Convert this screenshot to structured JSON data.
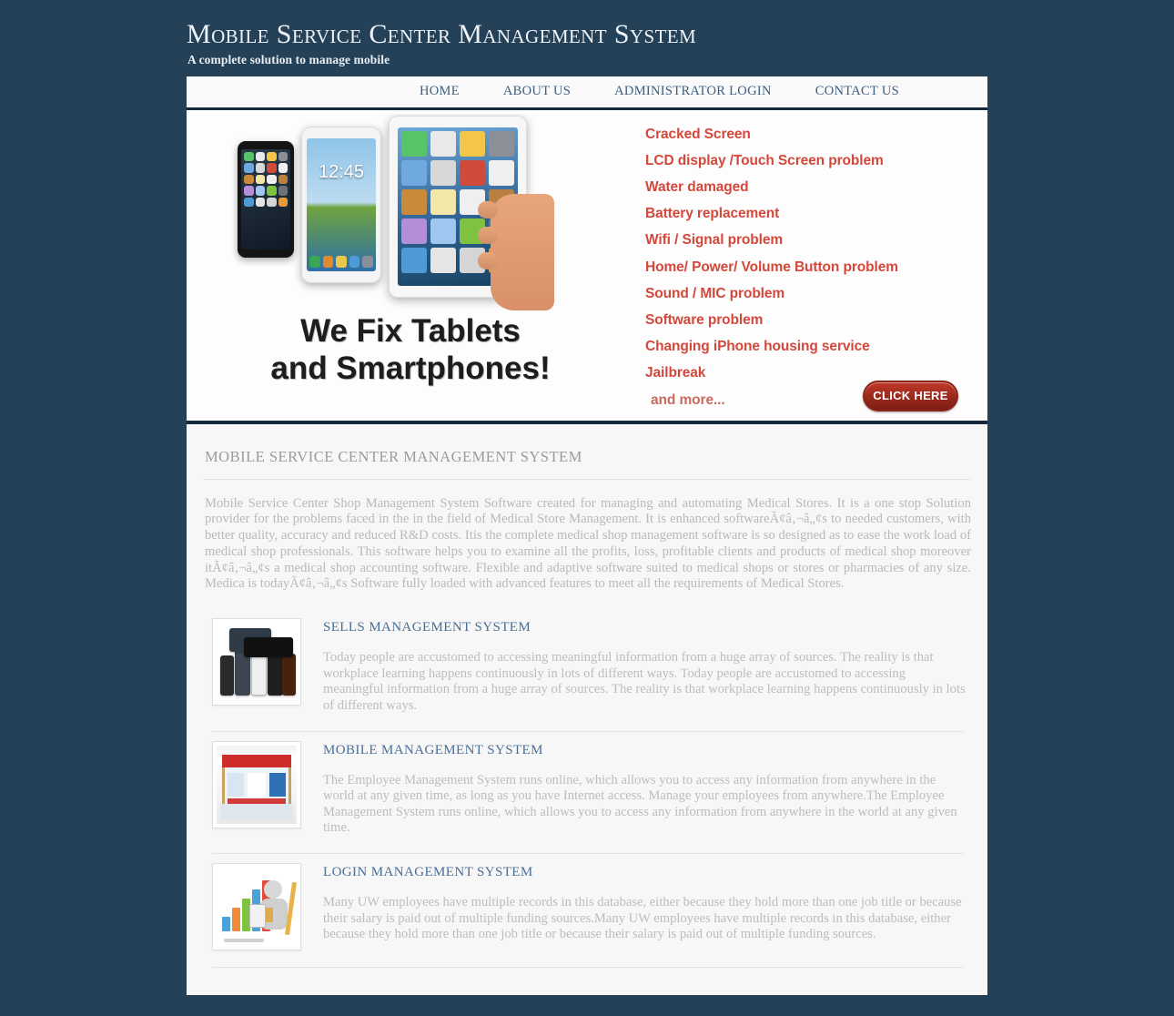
{
  "site": {
    "title": "Mobile Service Center Management System",
    "tagline": "A complete solution to manage mobile"
  },
  "nav": {
    "items": [
      {
        "label": "HOME",
        "name": "nav-home"
      },
      {
        "label": "ABOUT US",
        "name": "nav-about-us"
      },
      {
        "label": "ADMINISTRATOR LOGIN",
        "name": "nav-administrator-login"
      },
      {
        "label": "CONTACT US",
        "name": "nav-contact-us"
      }
    ]
  },
  "banner": {
    "headline_line1": "We Fix Tablets",
    "headline_line2": "and Smartphones!",
    "services": [
      "Cracked Screen",
      "LCD display /Touch Screen problem",
      "Water damaged",
      "Battery replacement",
      "Wifi / Signal problem",
      "Home/ Power/ Volume Button problem",
      "Sound / MIC problem",
      "Software problem",
      "Changing iPhone housing service",
      "Jailbreak"
    ],
    "more_text": "and more...",
    "cta_label": "CLICK HERE",
    "phone_time": "12:45"
  },
  "main": {
    "section_title": "MOBILE SERVICE CENTER MANAGEMENT SYSTEM",
    "intro": "Mobile Service Center Shop Management System Software created for managing and automating Medical Stores. It is a one stop Solution provider for the problems faced in the in the field of Medical Store Management. It is enhanced softwareÃ¢â‚¬â„¢s to needed customers, with better quality, accuracy and reduced R&D costs. Itis the complete medical shop management software is so designed as to ease the work load of medical shop professionals. This software helps you to examine all the profits, loss, profitable clients and products of medical shop moreover itÃ¢â‚¬â„¢s a medical shop accounting software. Flexible and adaptive software suited to medical shops or stores or pharmacies of any size. Medica is todayÃ¢â‚¬â„¢s Software fully loaded with advanced features to meet all the requirements of Medical Stores.",
    "features": [
      {
        "title": "SELLS MANAGEMENT SYSTEM",
        "text": "Today people are accustomed to accessing meaningful information from a huge array of sources. The reality is that workplace learning happens continuously in lots of different ways. Today people are accustomed to accessing meaningful information from a huge array of sources. The reality is that workplace learning happens continuously in lots of different ways.",
        "image_name": "smartphones-group-photo"
      },
      {
        "title": "MOBILE MANAGEMENT SYSTEM",
        "text": "The Employee Management System runs online, which allows you to access any information from anywhere in the world at any given time, as long as you have Internet access. Manage your employees from anywhere.The Employee Management System runs online, which allows you to access any information from anywhere in the world at any given time.",
        "image_name": "mobile-store-front-photo"
      },
      {
        "title": "LOGIN MANAGEMENT SYSTEM",
        "text": "Many UW employees have multiple records in this database, either because they hold more than one job title or because their salary is paid out of multiple funding sources.Many UW employees have multiple records in this database, either because they hold more than one job title or because their salary is paid out of multiple funding sources.",
        "image_name": "bar-chart-figure-photo"
      }
    ]
  },
  "colors": {
    "page_background": "#244158",
    "nav_text": "#3d5e80",
    "banner_service_text": "#d4483b",
    "cta_red": "#a02b1e",
    "feature_title": "#4a6f96",
    "body_text": "#bdbdbd"
  }
}
